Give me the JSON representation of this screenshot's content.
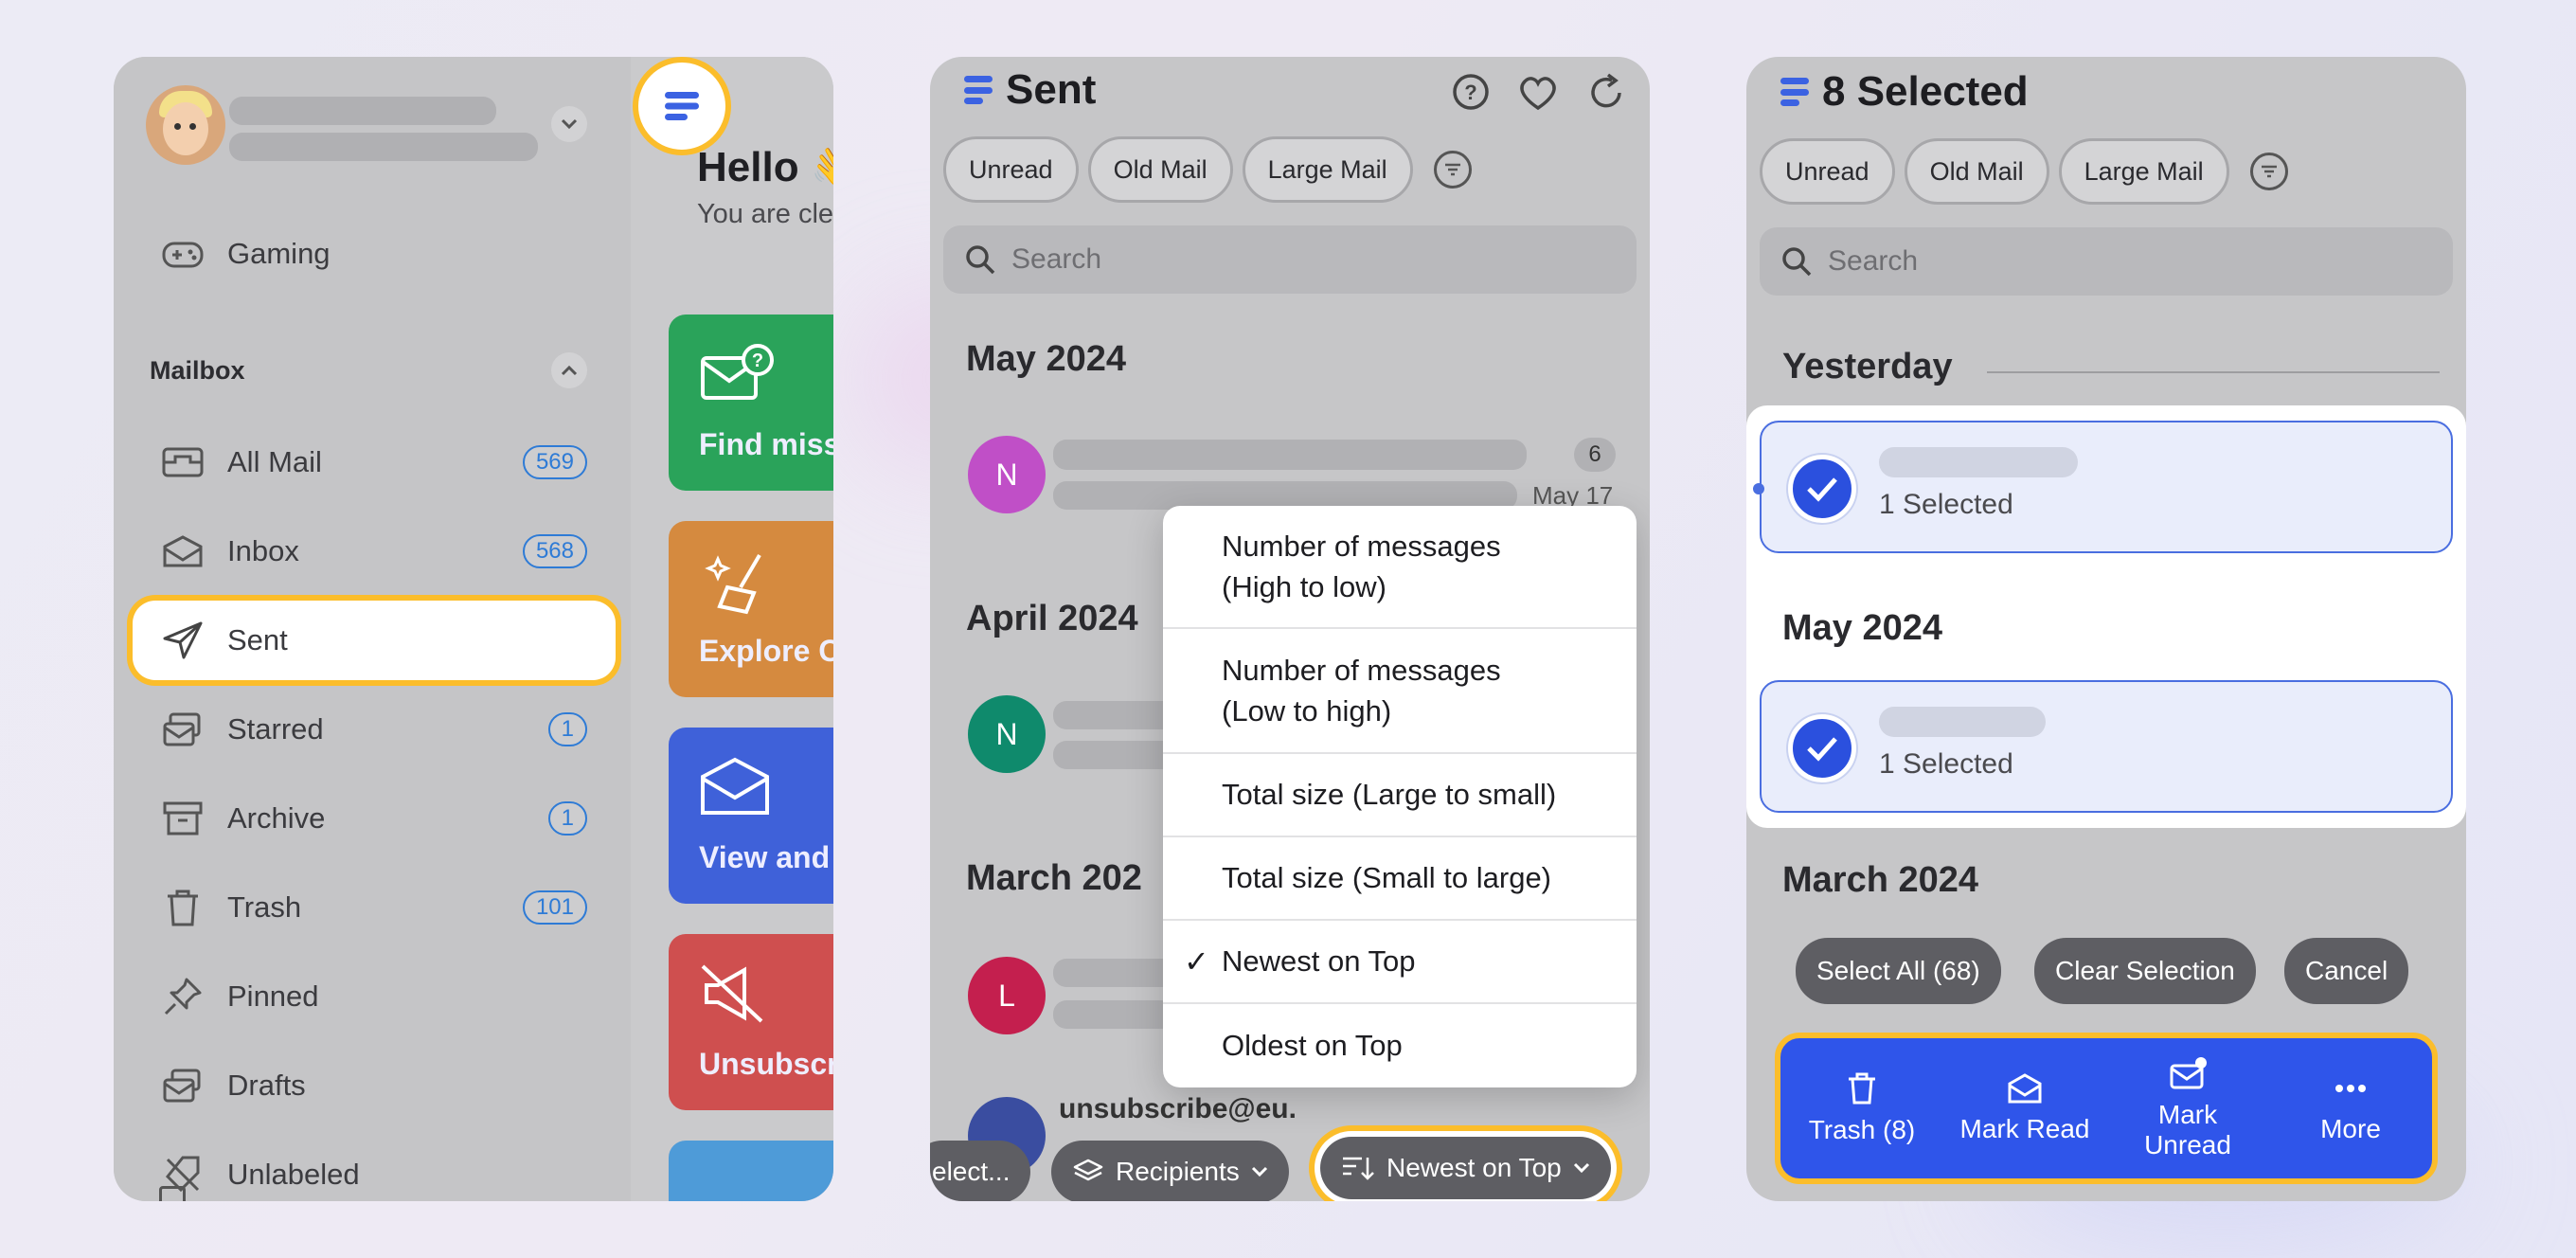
{
  "panel1": {
    "mailbox_title": "Mailbox",
    "items": [
      {
        "label": "Gaming",
        "badge": ""
      },
      {
        "label": "All Mail",
        "badge": "569"
      },
      {
        "label": "Inbox",
        "badge": "568"
      },
      {
        "label": "Sent",
        "badge": ""
      },
      {
        "label": "Starred",
        "badge": "1"
      },
      {
        "label": "Archive",
        "badge": "1"
      },
      {
        "label": "Trash",
        "badge": "101"
      },
      {
        "label": "Pinned",
        "badge": ""
      },
      {
        "label": "Drafts",
        "badge": ""
      },
      {
        "label": "Unlabeled",
        "badge": ""
      }
    ],
    "hello": "Hello 👋",
    "hello_sub": "You are cle",
    "tiles": [
      {
        "label": "Find miss",
        "color": "#2aa35a"
      },
      {
        "label": "Explore C",
        "color": "#d58a3f"
      },
      {
        "label": "View and",
        "color": "#3f61d9"
      },
      {
        "label": "Unsubscri",
        "color": "#cf4f4f"
      }
    ]
  },
  "panel2": {
    "title": "Sent",
    "chips": [
      "Unread",
      "Old Mail",
      "Large Mail"
    ],
    "search_placeholder": "Search",
    "groups": [
      "May 2024",
      "April 2024",
      "March 202"
    ],
    "mail_initials": [
      "N",
      "N",
      "L"
    ],
    "mail_count": "6",
    "mail_date": "May 17",
    "sender_peek": "unsubscribe@eu.",
    "sort_options": [
      "Number of messages\n(High to low)",
      "Number of messages\n(Low to high)",
      "Total size (Large to small)",
      "Total size (Small to large)",
      "Newest on Top",
      "Oldest on Top"
    ],
    "checkmark": "✓",
    "bottom": {
      "select": "elect...",
      "recipients": "Recipients",
      "sort": "Newest on Top"
    }
  },
  "panel3": {
    "title": "8 Selected",
    "chips": [
      "Unread",
      "Old Mail",
      "Large Mail"
    ],
    "search_placeholder": "Search",
    "groups": [
      "Yesterday",
      "May 2024",
      "March 2024"
    ],
    "cards": [
      "1 Selected",
      "1 Selected"
    ],
    "pills": [
      "Select All (68)",
      "Clear Selection",
      "Cancel"
    ],
    "actions": [
      "Trash (8)",
      "Mark Read",
      "Mark\nUnread",
      "More"
    ]
  },
  "colors": {
    "accent": "#3b62e2",
    "highlight": "#fbbd2b",
    "action_bar": "#2f55ea"
  }
}
